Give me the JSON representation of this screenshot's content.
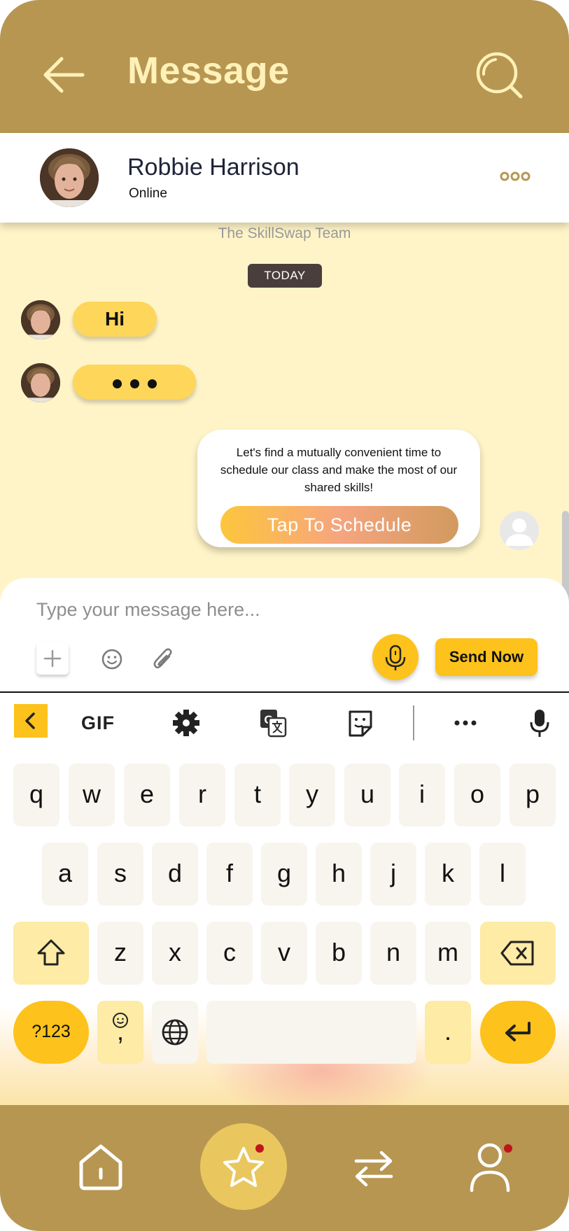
{
  "header": {
    "title": "Message"
  },
  "contact": {
    "name": "Robbie Harrison",
    "status": "Online"
  },
  "chat": {
    "team_label": "The SkillSwap Team",
    "date_chip": "TODAY",
    "messages": [
      {
        "sender": "Robbie Harrison",
        "text": "Hi"
      }
    ],
    "schedule_card": {
      "text": "Let's find a mutually convenient time to schedule our class and make the most of our shared skills!",
      "button_label": "Tap To Schedule"
    }
  },
  "composer": {
    "placeholder": "Type your message here...",
    "send_label": "Send Now"
  },
  "keyboard": {
    "toolbar": [
      "back-icon",
      "GIF",
      "gear-icon",
      "translate-icon",
      "sticker-icon",
      "more-icon",
      "mic-icon"
    ],
    "gif_label": "GIF",
    "rows": [
      [
        "q",
        "w",
        "e",
        "r",
        "t",
        "y",
        "u",
        "i",
        "o",
        "p"
      ],
      [
        "a",
        "s",
        "d",
        "f",
        "g",
        "h",
        "j",
        "k",
        "l"
      ],
      [
        "z",
        "x",
        "c",
        "v",
        "b",
        "n",
        "m"
      ]
    ],
    "symbols_label": "?123",
    "comma_label": ",",
    "period_label": "."
  },
  "nav": {
    "items": [
      "home-icon",
      "star-icon",
      "swap-icon",
      "profile-icon"
    ]
  },
  "colors": {
    "header": "#B79652",
    "header_text": "#FFF1B8",
    "chat_background": "#FFF4C8",
    "bubble": "#FDD65A",
    "accent": "#FDC21B",
    "notification": "#C0141B"
  }
}
